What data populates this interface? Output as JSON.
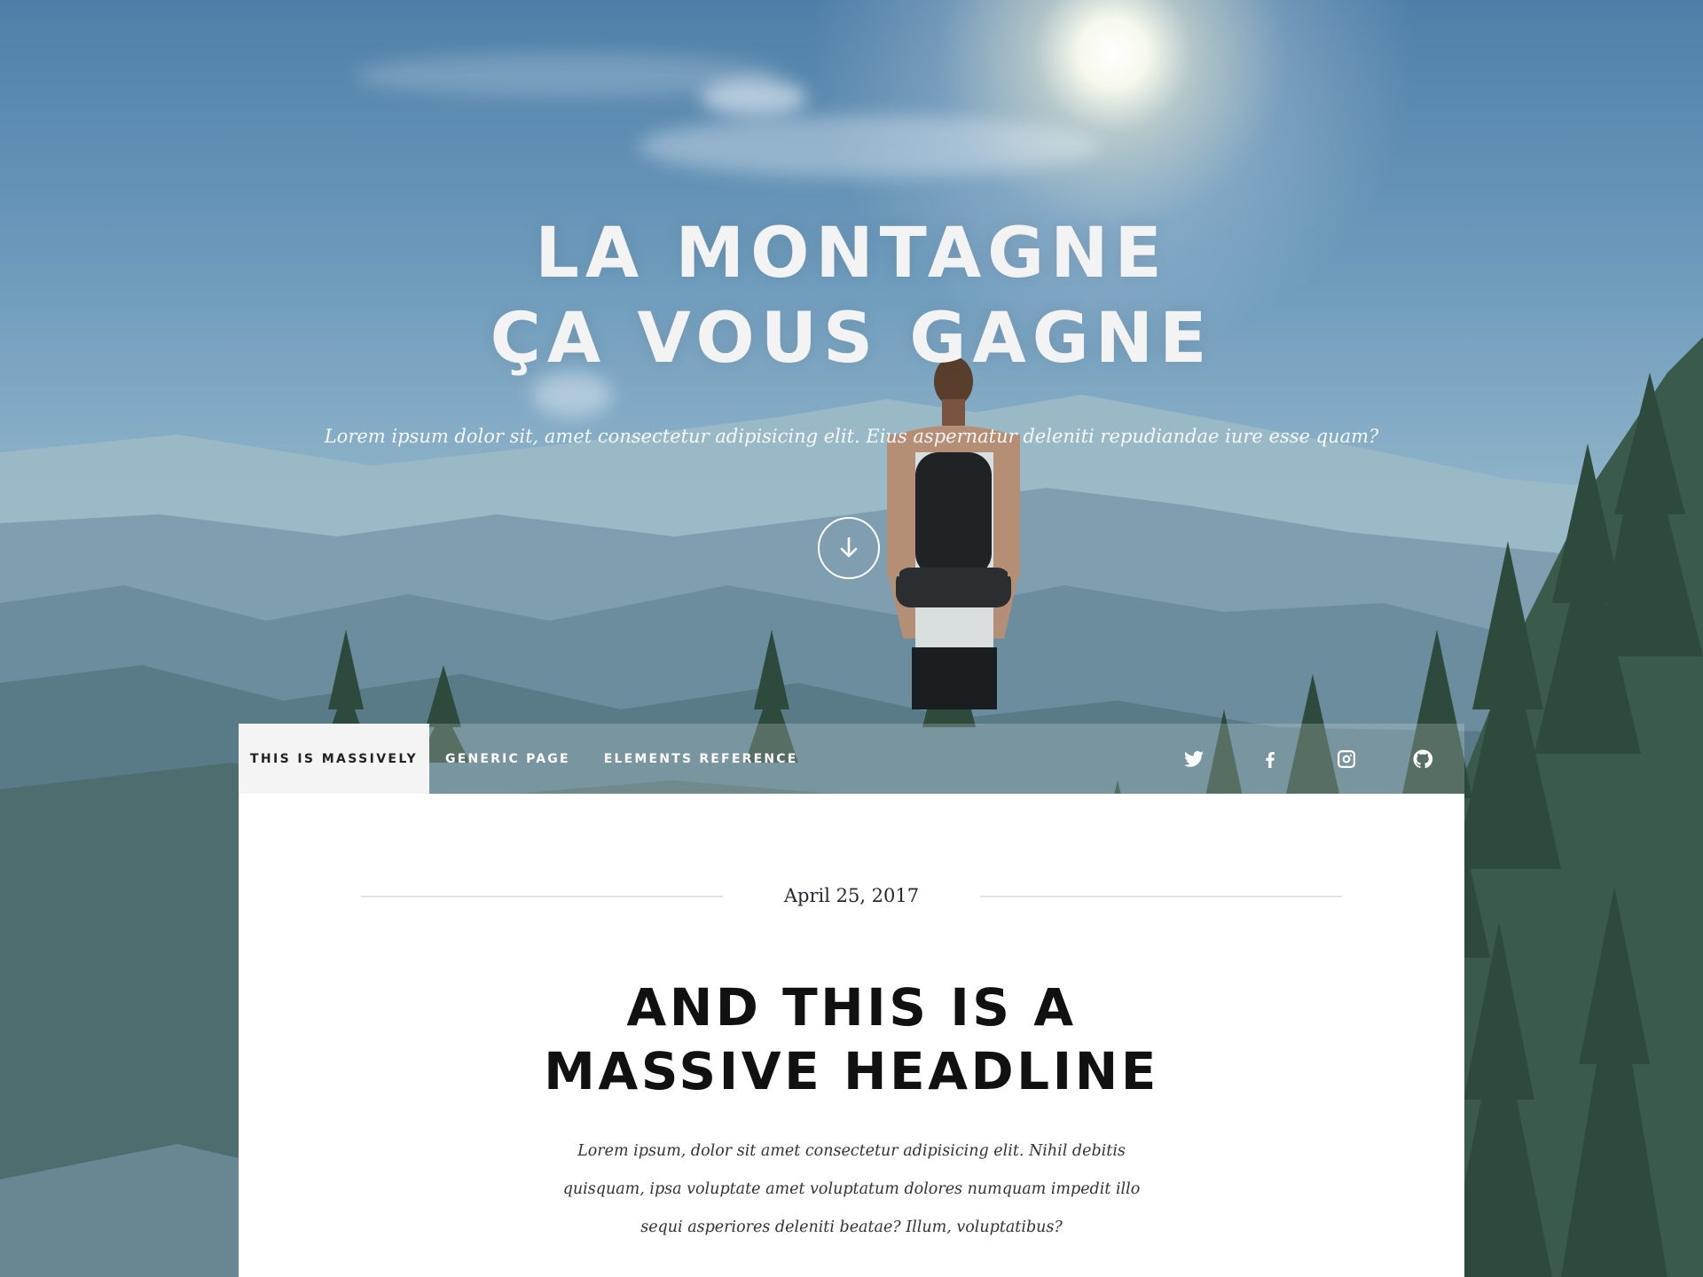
{
  "intro": {
    "title_line1": "LA MONTAGNE",
    "title_line2": "ÇA VOUS GAGNE",
    "subtitle": "Lorem ipsum dolor sit, amet consectetur adipisicing elit. Eius aspernatur deleniti repudiandae iure esse quam?",
    "scroll_icon": "arrow-down-icon"
  },
  "nav": {
    "logo": "THIS IS MASSIVELY",
    "links": [
      "GENERIC PAGE",
      "ELEMENTS REFERENCE"
    ],
    "icons": [
      "twitter-icon",
      "facebook-icon",
      "instagram-icon",
      "github-icon"
    ]
  },
  "post": {
    "date": "April 25, 2017",
    "headline_line1": "AND THIS IS A",
    "headline_line2": "MASSIVE HEADLINE",
    "lede": "Lorem ipsum, dolor sit amet consectetur adipisicing elit. Nihil debitis quisquam, ipsa voluptate amet voluptatum dolores numquam impedit illo sequi asperiores deleniti beatae? Illum, voluptatibus?"
  },
  "colors": {
    "title_text": "#f3f3f3",
    "nav_logo_bg": "#f4f4f4",
    "panel_bg": "#ffffff",
    "headline_text": "#111111"
  }
}
